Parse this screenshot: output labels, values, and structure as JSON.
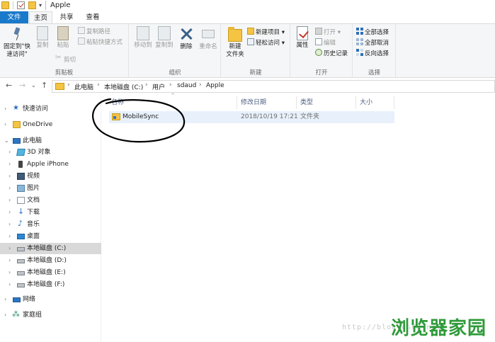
{
  "window": {
    "title": "Apple"
  },
  "tabs": [
    {
      "label": "文件"
    },
    {
      "label": "主页"
    },
    {
      "label": "共享"
    },
    {
      "label": "查看"
    }
  ],
  "ribbon": {
    "clipboard": {
      "group_label": "剪贴板",
      "pin_label_1": "固定到\"快",
      "pin_label_2": "速访问\"",
      "copy_label": "复制",
      "paste_label": "粘贴",
      "copy_path_label": "复制路径",
      "paste_shortcut_label": "粘贴快捷方式",
      "cut_label": "剪切"
    },
    "organize": {
      "group_label": "组织",
      "move_to_label": "移动到",
      "copy_to_label": "复制到",
      "delete_label": "删除",
      "rename_label": "重命名"
    },
    "new": {
      "group_label": "新建",
      "new_folder_label_1": "新建",
      "new_folder_label_2": "文件夹",
      "new_item_label": "新建项目 ▾",
      "easy_access_label": "轻松访问 ▾"
    },
    "open": {
      "group_label": "打开",
      "properties_label": "属性",
      "open_label": "打开 ▾",
      "edit_label": "编辑",
      "history_label": "历史记录"
    },
    "select": {
      "group_label": "选择",
      "select_all_label": "全部选择",
      "select_none_label": "全部取消",
      "invert_label": "反向选择"
    }
  },
  "address": {
    "crumbs": [
      "此电脑",
      "本地磁盘 (C:)",
      "用户",
      "sdaud",
      "Apple"
    ]
  },
  "nav": {
    "items": [
      {
        "label": "快速访问"
      },
      {
        "label": "OneDrive"
      },
      {
        "label": "此电脑"
      },
      {
        "label": "3D 对象"
      },
      {
        "label": "Apple iPhone"
      },
      {
        "label": "视频"
      },
      {
        "label": "图片"
      },
      {
        "label": "文档"
      },
      {
        "label": "下载"
      },
      {
        "label": "音乐"
      },
      {
        "label": "桌面"
      },
      {
        "label": "本地磁盘 (C:)"
      },
      {
        "label": "本地磁盘 (D:)"
      },
      {
        "label": "本地磁盘 (E:)"
      },
      {
        "label": "本地磁盘 (F:)"
      },
      {
        "label": "网络"
      },
      {
        "label": "家庭组"
      }
    ]
  },
  "columns": {
    "name": "名称",
    "modified": "修改日期",
    "type": "类型",
    "size": "大小"
  },
  "files": [
    {
      "name": "MobileSync",
      "modified": "2018/10/19 17:21",
      "type": "文件夹",
      "size": ""
    }
  ],
  "watermark": {
    "url": "http://blog.csdn.net",
    "brand": "浏览器家园"
  }
}
